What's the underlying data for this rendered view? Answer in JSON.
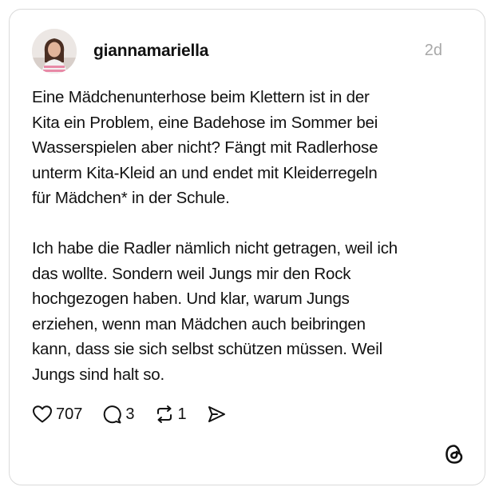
{
  "post": {
    "username": "giannamariella",
    "time": "2d",
    "paragraphs": [
      "Eine Mädchenunterhose beim Klettern ist in der\nKita ein Problem, eine Badehose im Sommer bei\nWasserspielen aber nicht? Fängt mit Radlerhose\nunterm Kita-Kleid an und endet mit Kleiderregeln\nfür Mädchen* in der Schule.",
      "Ich habe die Radler nämlich nicht getragen, weil ich\ndas wollte. Sondern weil Jungs mir den Rock\nhochgezogen haben. Und klar, warum Jungs\nerziehen, wenn man Mädchen auch beibringen\nkann, dass sie sich selbst schützen müssen. Weil\nJungs sind halt so."
    ]
  },
  "actions": {
    "likes": "707",
    "replies": "3",
    "reposts": "1"
  },
  "icons": {
    "like": "heart-icon",
    "reply": "speech-bubble-icon",
    "repost": "repost-icon",
    "share": "send-icon",
    "brand": "threads-logo"
  }
}
